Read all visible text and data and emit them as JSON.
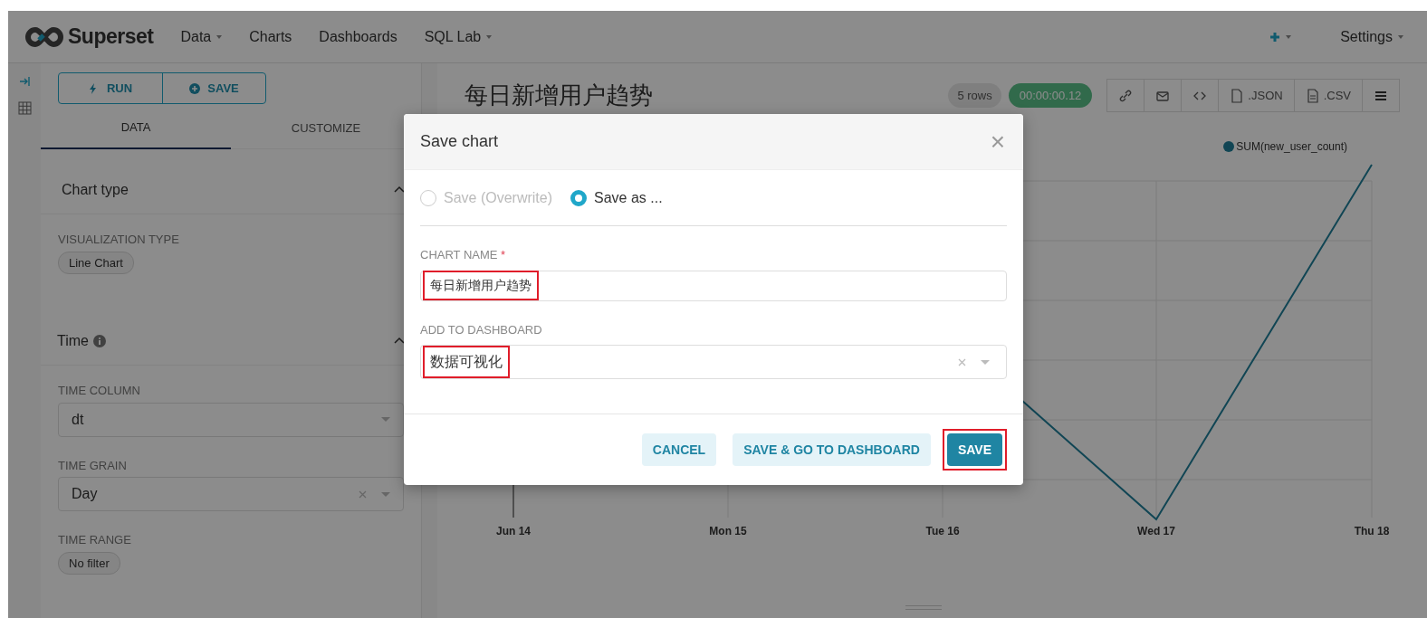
{
  "navbar": {
    "brand": "Superset",
    "menu": [
      {
        "label": "Data",
        "dropdown": true
      },
      {
        "label": "Charts",
        "dropdown": false
      },
      {
        "label": "Dashboards",
        "dropdown": false
      },
      {
        "label": "SQL Lab",
        "dropdown": true
      }
    ],
    "settings": {
      "label": "Settings",
      "dropdown": true
    }
  },
  "control_panel": {
    "actions": [
      {
        "kind": "run",
        "label": "RUN"
      },
      {
        "kind": "save",
        "label": "SAVE"
      }
    ],
    "tabs": [
      {
        "label": "DATA",
        "selected": true
      },
      {
        "label": "CUSTOMIZE",
        "selected": false
      }
    ],
    "sections": [
      {
        "title": "Chart type",
        "info": false,
        "expanded": true,
        "controls": [
          {
            "kind": "pill",
            "label": "VISUALIZATION TYPE",
            "value": "Line Chart"
          }
        ]
      },
      {
        "title": "Time",
        "info": true,
        "expanded": true,
        "controls": [
          {
            "kind": "select",
            "label": "TIME COLUMN",
            "value": "dt",
            "clearable": false
          },
          {
            "kind": "select",
            "label": "TIME GRAIN",
            "value": "Day",
            "clearable": true
          },
          {
            "kind": "pill",
            "label": "TIME RANGE",
            "value": "No filter"
          }
        ]
      }
    ]
  },
  "chart_header": {
    "title": "每日新增用户趋势",
    "row_count": "5 rows",
    "timer": "00:00:00.12",
    "actions": [
      {
        "kind": "link"
      },
      {
        "kind": "email"
      },
      {
        "kind": "code"
      },
      {
        "kind": "json",
        "label": ".JSON"
      },
      {
        "kind": "csv",
        "label": ".CSV"
      },
      {
        "kind": "menu"
      }
    ]
  },
  "chart": {
    "legend": "SUM(new_user_count)",
    "x_labels": [
      "Jun 14",
      "Mon 15",
      "Tue 16",
      "Wed 17",
      "Thu 18"
    ]
  },
  "modal": {
    "title": "Save chart",
    "close": "×",
    "options": [
      {
        "label": "Save (Overwrite)",
        "selected": false,
        "disabled": true
      },
      {
        "label": "Save as ...",
        "selected": true,
        "disabled": false
      }
    ],
    "chart_name": {
      "label": "CHART NAME",
      "required_mark": "*",
      "value": "每日新增用户趋势",
      "highlighted": true
    },
    "dashboard": {
      "label": "ADD TO DASHBOARD",
      "value": "数据可视化",
      "highlighted": true
    },
    "buttons": [
      {
        "label": "CANCEL",
        "kind": "secondary",
        "highlighted": false
      },
      {
        "label": "SAVE & GO TO DASHBOARD",
        "kind": "secondary",
        "highlighted": false
      },
      {
        "label": "SAVE",
        "kind": "primary",
        "highlighted": true
      }
    ]
  }
}
